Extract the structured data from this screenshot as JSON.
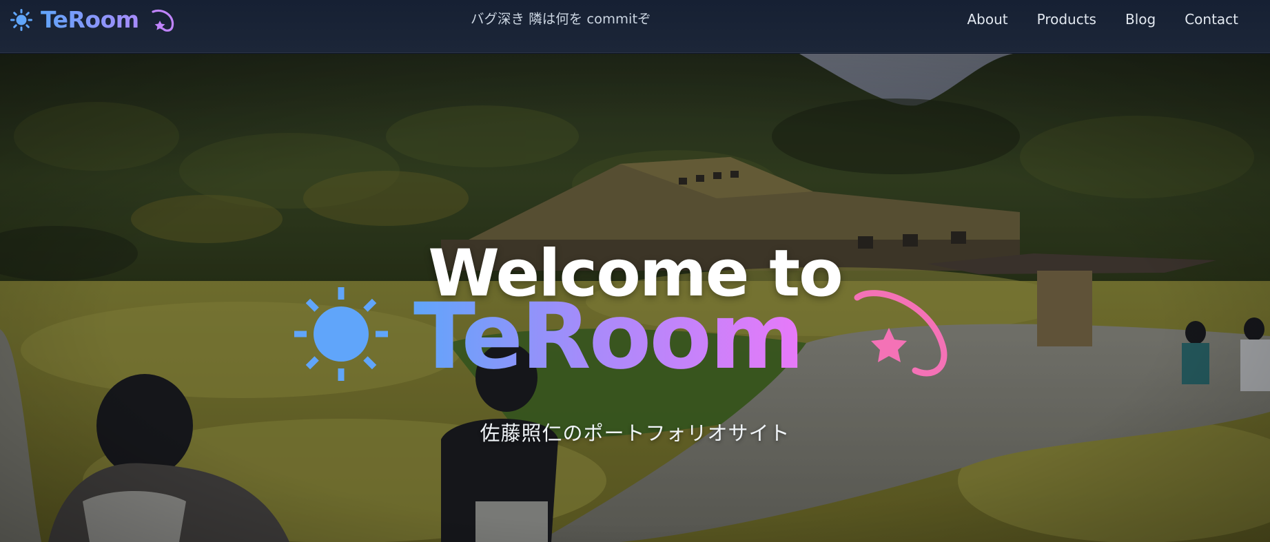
{
  "header": {
    "brand_name": "TeRoom",
    "tagline": "バグ深き 隣は何を commitぞ",
    "nav": [
      {
        "label": "About"
      },
      {
        "label": "Products"
      },
      {
        "label": "Blog"
      },
      {
        "label": "Contact"
      }
    ]
  },
  "hero": {
    "title": "Welcome to",
    "brand_name": "TeRoom",
    "subtitle": "佐藤照仁のポートフォリオサイト"
  },
  "icons": {
    "brand_left": "sun-icon",
    "brand_right": "shooting-star-icon"
  },
  "colors": {
    "nav_background": "#1c2638",
    "brand_gradient_start": "#60a5fa",
    "brand_gradient_end": "#e879f9",
    "sun": "#60a5fa",
    "comet": "#f472b6"
  }
}
